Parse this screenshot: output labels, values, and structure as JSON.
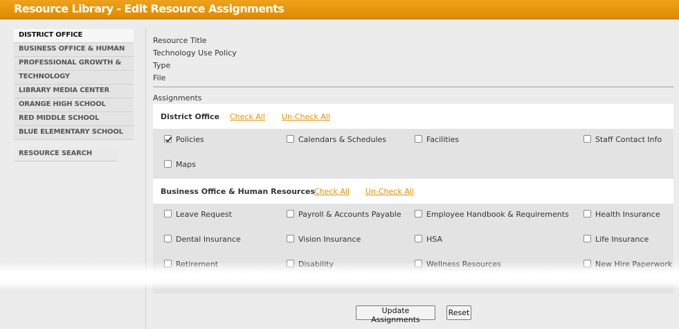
{
  "header": {
    "title": "Resource Library - Edit Resource Assignments"
  },
  "sidebar": {
    "items": [
      {
        "label": "DISTRICT OFFICE",
        "active": true
      },
      {
        "label": "BUSINESS OFFICE & HUMAN",
        "active": false
      },
      {
        "label": "PROFESSIONAL GROWTH &",
        "active": false
      },
      {
        "label": "TECHNOLOGY",
        "active": false
      },
      {
        "label": "LIBRARY MEDIA CENTER",
        "active": false
      },
      {
        "label": "ORANGE HIGH SCHOOL",
        "active": false
      },
      {
        "label": "RED MIDDLE SCHOOL",
        "active": false
      },
      {
        "label": "BLUE ELEMENTARY SCHOOL",
        "active": false
      }
    ],
    "search_label": "RESOURCE SEARCH"
  },
  "resource": {
    "title_label": "Resource Title",
    "title_value": "Technology Use Policy",
    "type_label": "Type",
    "type_value": "File"
  },
  "assignments_label": "Assignments",
  "groups": [
    {
      "title": "District Office",
      "check_all": "Check All",
      "uncheck_all": "Un-Check All",
      "items": [
        {
          "label": "Policies",
          "checked": true
        },
        {
          "label": "Calendars & Schedules",
          "checked": false
        },
        {
          "label": "Facilities",
          "checked": false
        },
        {
          "label": "Staff Contact Info",
          "checked": false
        },
        {
          "label": "Maps",
          "checked": false
        }
      ]
    },
    {
      "title": "Business Office & Human Resources",
      "check_all": "Check All",
      "uncheck_all": "Un-Check All",
      "items": [
        {
          "label": "Leave Request",
          "checked": false
        },
        {
          "label": "Payroll & Accounts Payable",
          "checked": false
        },
        {
          "label": "Employee Handbook & Requirements",
          "checked": false
        },
        {
          "label": "Health Insurance",
          "checked": false
        },
        {
          "label": "Dental Insurance",
          "checked": false
        },
        {
          "label": "Vision Insurance",
          "checked": false
        },
        {
          "label": "HSA",
          "checked": false
        },
        {
          "label": "Life Insurance",
          "checked": false
        },
        {
          "label": "Retirement",
          "checked": false
        },
        {
          "label": "Disability",
          "checked": false
        },
        {
          "label": "Wellness Resources",
          "checked": false
        },
        {
          "label": "New Hire Paperwork",
          "checked": false
        }
      ]
    }
  ],
  "buttons": {
    "update": "Update Assignments",
    "reset": "Reset"
  }
}
